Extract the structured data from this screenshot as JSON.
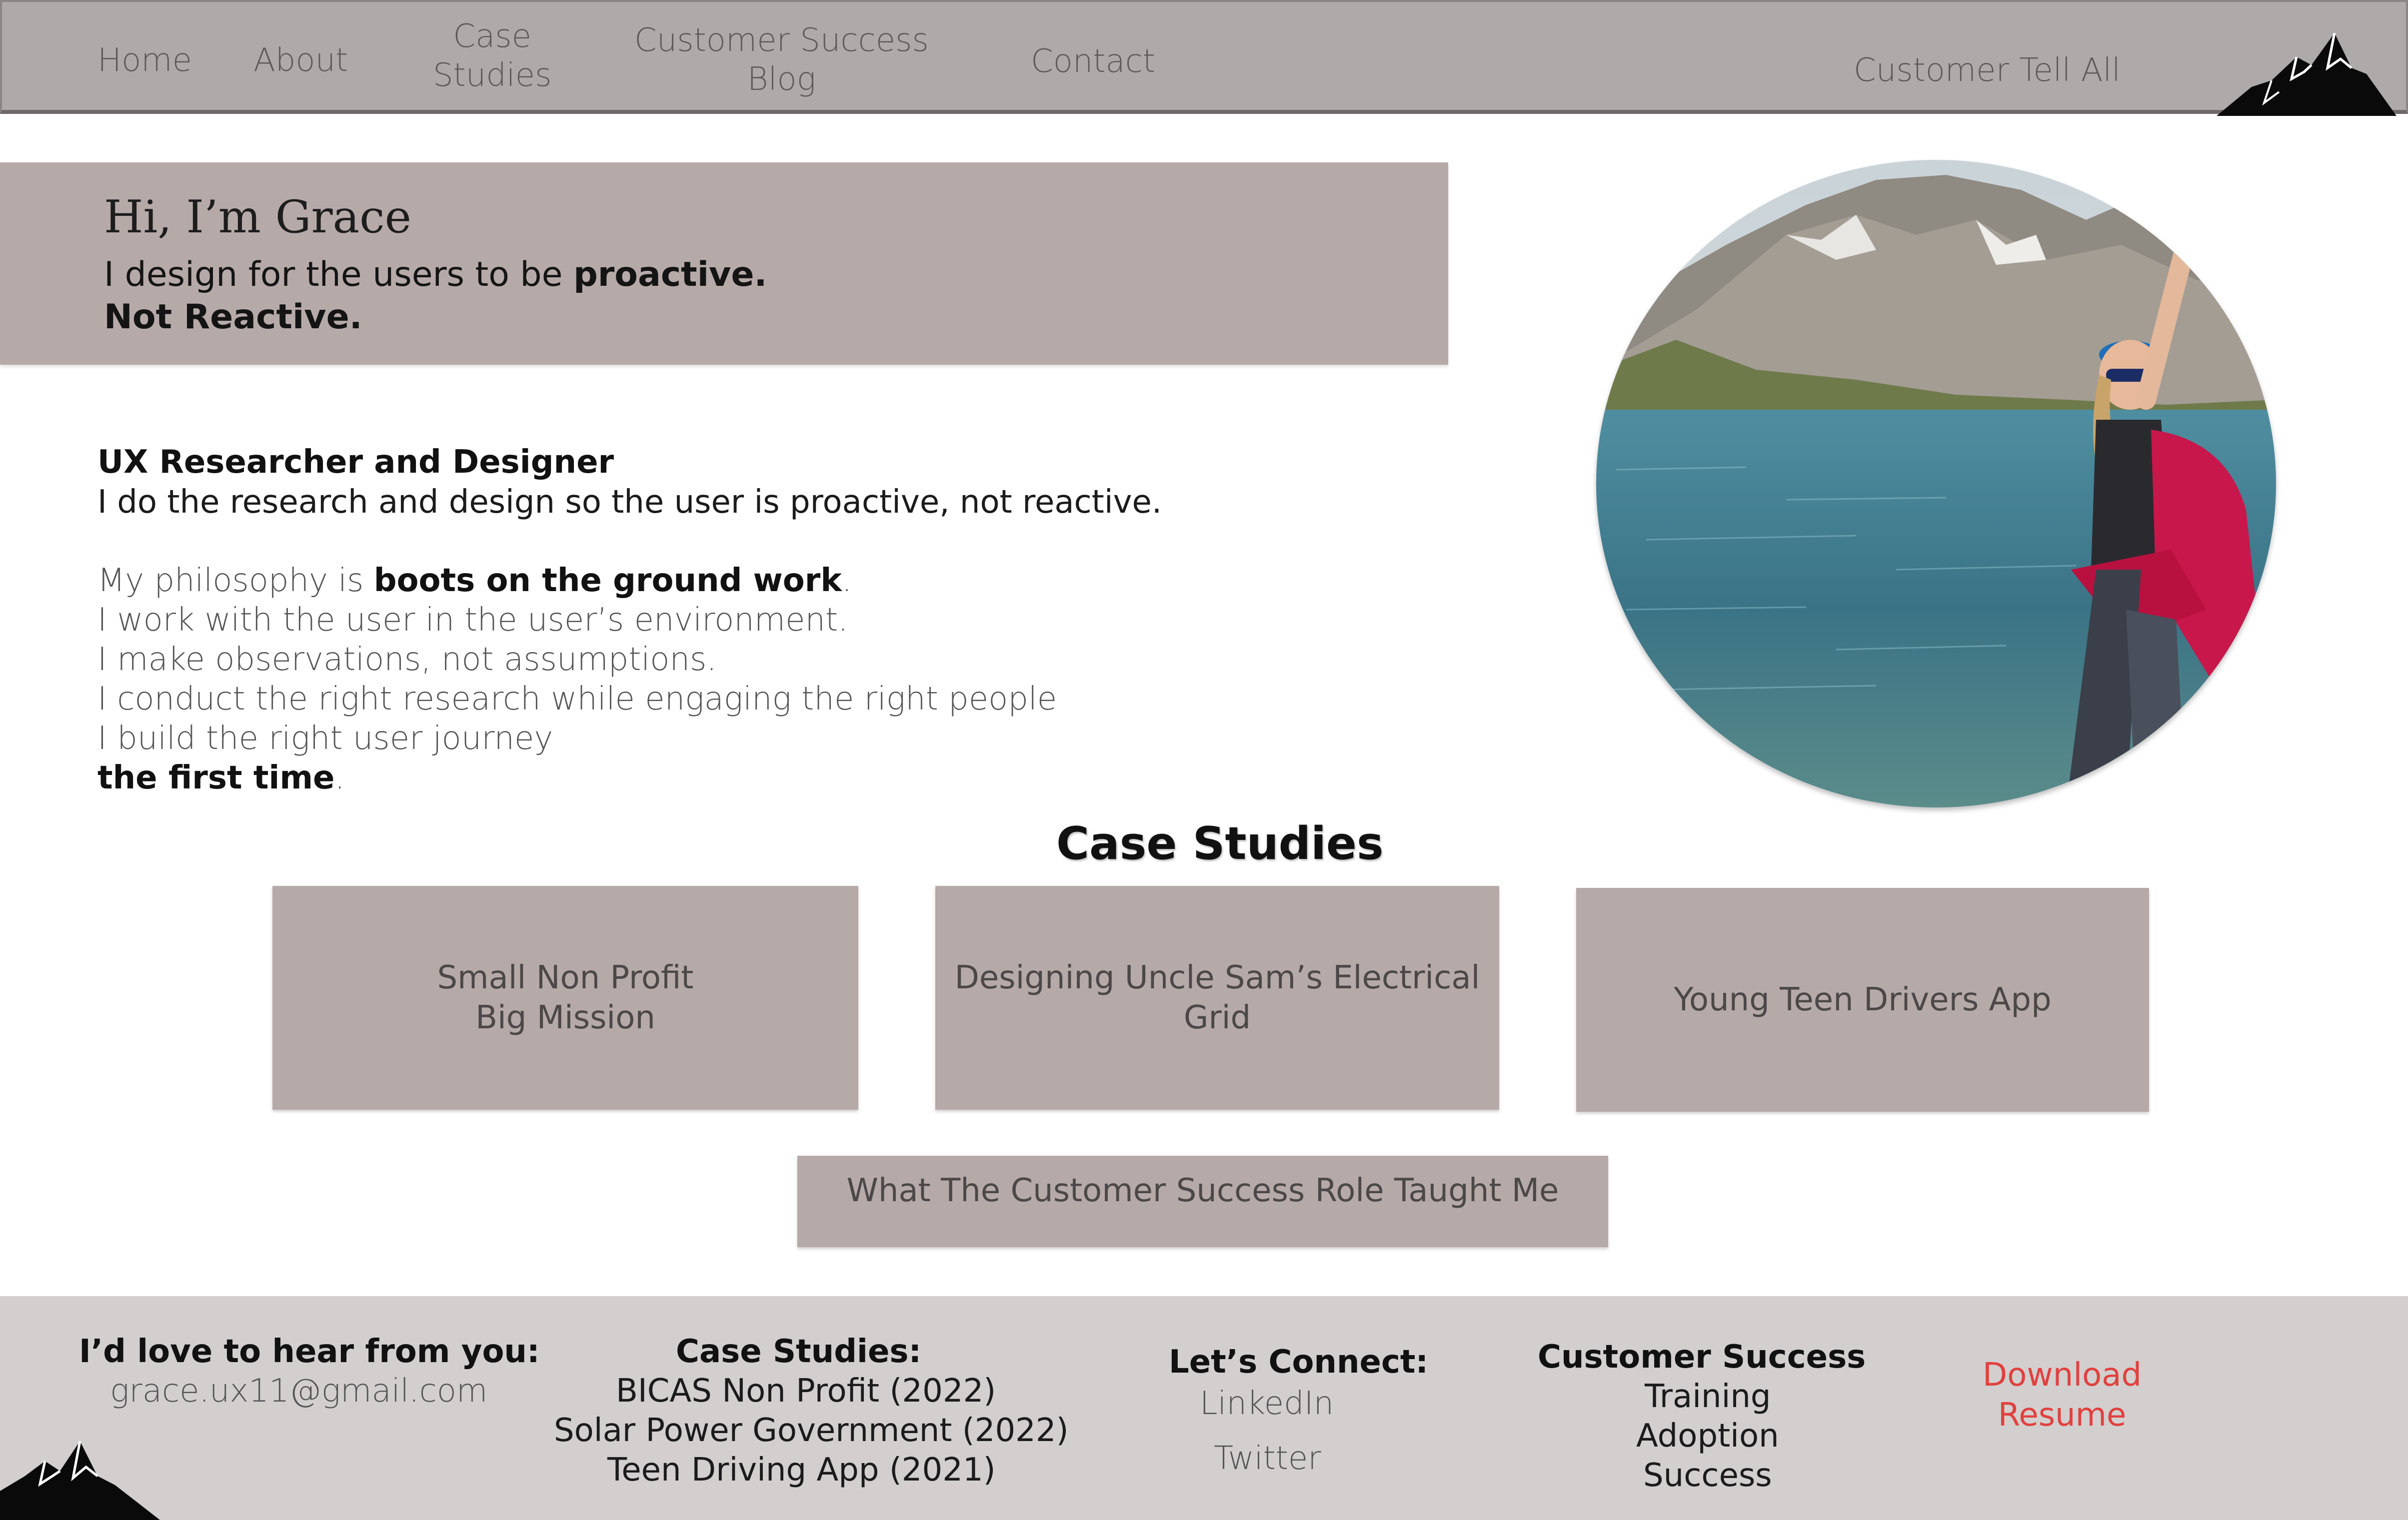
{
  "nav": {
    "home": "Home",
    "about": "About",
    "case_studies_line1": "Case",
    "case_studies_line2": "Studies",
    "blog_line1": "Customer Success",
    "blog_line2": "Blog",
    "contact": "Contact",
    "tell_all": "Customer Tell All"
  },
  "hero": {
    "greeting": "Hi, I’m Grace",
    "tagline_prefix": "I design for the users to be ",
    "tagline_bold": "proactive.",
    "tagline_line2": "Not Reactive."
  },
  "bio": {
    "title": "UX Researcher and Designer",
    "line1": "I do the research and design so the user is proactive, not reactive.",
    "philosophy_prefix": "My philosophy is ",
    "philosophy_bold": "boots on the ground work",
    "philosophy_suffix": ".",
    "line3": "I work with the user in the user’s environment.",
    "line4": "I make observations, not assumptions.",
    "line5": "I conduct the right research while engaging the right people",
    "line6": "I build the right user journey",
    "line7_bold": "the first time",
    "line7_suffix": "."
  },
  "case_studies": {
    "heading": "Case Studies",
    "card1_line1": "Small Non Profit",
    "card1_line2": "Big Mission",
    "card2_line1": "Designing Uncle Sam’s  Electrical",
    "card2_line2": "Grid",
    "card3": "Young Teen Drivers App",
    "card4": "What The  Customer Success Role Taught Me"
  },
  "footer": {
    "contact_heading": "I’d love to hear from you:",
    "email": "grace.ux11@gmail.com",
    "cs_heading": "Case Studies:",
    "cs_items": [
      "BICAS Non Profit (2022)",
      "Solar Power Government (2022)",
      "Teen Driving App (2021)"
    ],
    "connect_heading": "Let’s Connect:",
    "linkedin": "LinkedIn",
    "twitter": "Twitter",
    "success_heading": "Customer Success",
    "success_items": [
      "Training",
      "Adoption",
      "Success"
    ],
    "download_line1": "Download",
    "download_line2": "Resume"
  },
  "colors": {
    "nav_bg": "#aeaaa9",
    "card_bg": "#b6aaa9",
    "footer_bg": "#d2cfce",
    "download_link": "#e0413f"
  },
  "icons": [
    "mountain-logo-icon",
    "mountain-footer-icon"
  ]
}
